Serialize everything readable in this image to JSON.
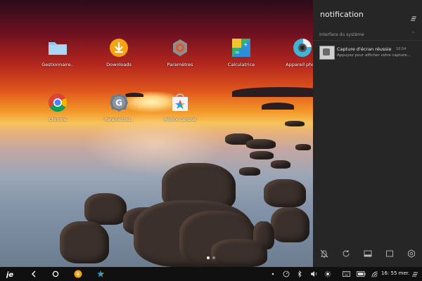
{
  "desktop": {
    "row1": [
      {
        "label": "Gestionnaire..",
        "icon": "folder-icon"
      },
      {
        "label": "Downloads",
        "icon": "download-icon"
      },
      {
        "label": "Paramètres",
        "icon": "settings-gear-icon"
      },
      {
        "label": "Calculatrice",
        "icon": "calculator-icon"
      },
      {
        "label": "Appareil photo",
        "icon": "camera-icon"
      }
    ],
    "row2": [
      {
        "label": "Chrome",
        "icon": "chrome-icon"
      },
      {
        "label": "Paramètres..",
        "icon": "google-settings-icon"
      },
      {
        "label": "Remix Central",
        "icon": "remix-central-icon"
      }
    ]
  },
  "notification_panel": {
    "title": "notification",
    "section": "Interface du système",
    "notification": {
      "title": "Capture d'écran réussie",
      "time": "16:54",
      "text": "Appuyez pour afficher votre capture..."
    }
  },
  "taskbar": {
    "clock": "16: 55 mer."
  },
  "colors": {
    "panel_bg": "#262626",
    "taskbar_bg": "#101010",
    "downloads_orange": "#f4a312",
    "folder_blue": "#8ec9f0"
  }
}
